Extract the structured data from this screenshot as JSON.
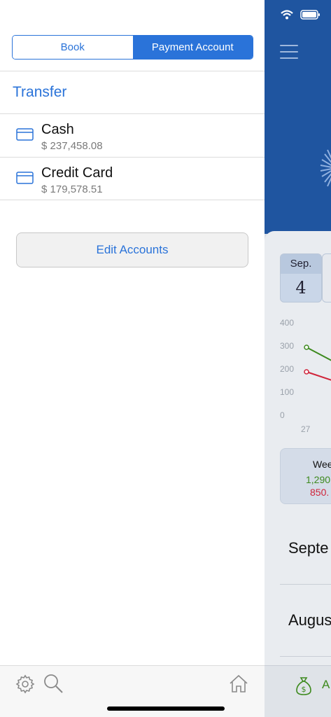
{
  "segmented": {
    "book_label": "Book",
    "payment_account_label": "Payment Account",
    "selected": "Payment Account"
  },
  "transfer_label": "Transfer",
  "accounts": [
    {
      "name": "Cash",
      "balance": "$ 237,458.08",
      "icon": "card-icon"
    },
    {
      "name": "Credit Card",
      "balance": "$ 179,578.51",
      "icon": "card-icon"
    }
  ],
  "edit_accounts_label": "Edit Accounts",
  "toolbar": {
    "icons": [
      "gear-icon",
      "search-icon",
      "home-icon"
    ]
  },
  "background": {
    "date": {
      "month": "Sep.",
      "day": "4"
    },
    "axis_ticks": [
      "400",
      "300",
      "200",
      "100",
      "0"
    ],
    "x_tick": "27",
    "week_summary": {
      "title": "Wee",
      "income": "1,290",
      "expense": "850."
    },
    "months": [
      "Septe",
      "Augus"
    ],
    "tab_label": "A"
  },
  "colors": {
    "accent": "#2a73d9",
    "header_blue": "#1f55a0",
    "income_green": "#3d8a1e",
    "expense_red": "#d0243a"
  }
}
